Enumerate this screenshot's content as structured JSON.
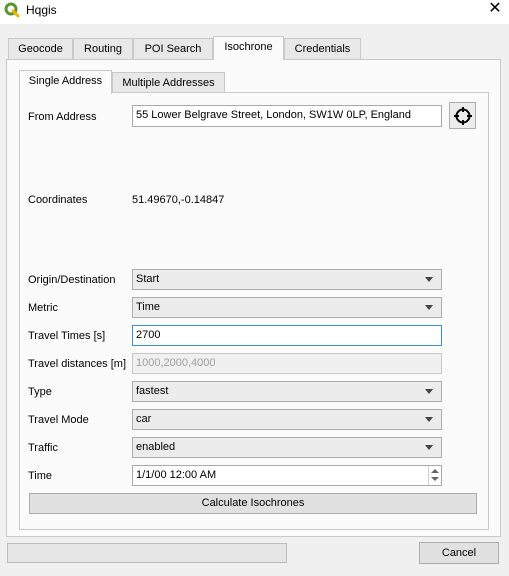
{
  "window": {
    "title": "Hqgis",
    "close_glyph": "✕"
  },
  "tabs": [
    {
      "label": "Geocode",
      "active": false
    },
    {
      "label": "Routing",
      "active": false
    },
    {
      "label": "POI Search",
      "active": false
    },
    {
      "label": "Isochrone",
      "active": true
    },
    {
      "label": "Credentials",
      "active": false
    }
  ],
  "subtabs": [
    {
      "label": "Single Address",
      "active": true
    },
    {
      "label": "Multiple Addresses",
      "active": false
    }
  ],
  "form": {
    "from_address_label": "From Address",
    "from_address_value": "55 Lower Belgrave Street, London, SW1W 0LP, England",
    "coordinates_label": "Coordinates",
    "coordinates_value": "51.49670,-0.14847",
    "origin_label": "Origin/Destination",
    "origin_value": "Start",
    "metric_label": "Metric",
    "metric_value": "Time",
    "travel_times_label": "Travel Times [s]",
    "travel_times_value": "2700",
    "travel_distances_label": "Travel distances [m]",
    "travel_distances_placeholder": "1000,2000,4000",
    "type_label": "Type",
    "type_value": "fastest",
    "travel_mode_label": "Travel Mode",
    "travel_mode_value": "car",
    "traffic_label": "Traffic",
    "traffic_value": "enabled",
    "time_label": "Time",
    "time_value": "1/1/00 12:00 AM"
  },
  "buttons": {
    "calculate": "Calculate Isochrones",
    "cancel": "Cancel"
  },
  "colors": {
    "focus_border": "#3d8ee0",
    "qgis_green": "#589632"
  },
  "icons": {
    "app": "qgis-logo-icon",
    "locate": "crosshair-icon"
  }
}
